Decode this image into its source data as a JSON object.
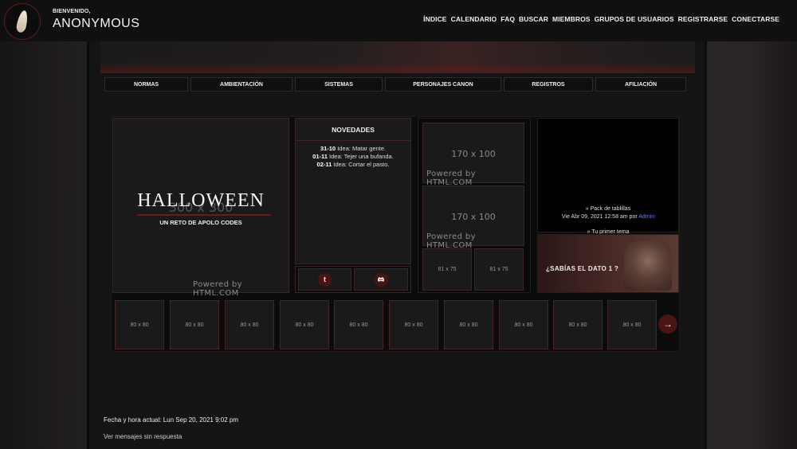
{
  "user": {
    "welcome": "BIENVENIDO,",
    "name": "ANONYMOUS"
  },
  "topnav": [
    "ÍNDICE",
    "CALENDARIO",
    "FAQ",
    "BUSCAR",
    "MIEMBROS",
    "GRUPOS DE USUARIOS",
    "REGISTRARSE",
    "CONECTARSE"
  ],
  "menu": [
    "NORMAS",
    "AMBIENTACIÓN",
    "SISTEMAS",
    "PERSONAJES CANON",
    "REGISTROS",
    "AFILIACIÓN"
  ],
  "banner": {
    "title": "HALLOWEEN",
    "ghost": "300 x 300",
    "subtitle": "UN RETO DE APOLO CODES",
    "powered": "Powered by HTML.COM"
  },
  "novedades": {
    "title": "NOVEDADES",
    "items": [
      {
        "date": "31-10",
        "text": "Idea: Matar gente."
      },
      {
        "date": "01-11",
        "text": "Idea: Tejer una bufanda."
      },
      {
        "date": "02-11",
        "text": "Idea: Cortar el pasto."
      }
    ]
  },
  "social": {
    "tumblr": "t",
    "discord": "d"
  },
  "ads": {
    "large1": "170 x 100",
    "large1_powered": "Powered by HTML.COM",
    "large2": "170 x 100",
    "large2_powered": "Powered by HTML.COM",
    "small1": "81 x 75",
    "small2": "81 x 75"
  },
  "topics": {
    "title1": "» Pack de tablillas",
    "meta1_prefix": "Vie Abr 09, 2021 12:58 am por ",
    "meta1_author": "Admin",
    "title2": "» Tu primer tema"
  },
  "dato": {
    "text": "¿SABÍAS  EL DATO 1 ?"
  },
  "thumbs": [
    "80 x 80",
    "80 x 80",
    "80 x 80",
    "80 x 80",
    "80 x 80",
    "80 x 80",
    "80 x 80",
    "80 x 80",
    "80 x 80",
    "80 x 80"
  ],
  "next_arrow": "→",
  "footer": {
    "datetime": "Fecha y hora actual: Lun Sep 20, 2021 9:02 pm",
    "unanswered": "Ver mensajes sin respuesta"
  }
}
